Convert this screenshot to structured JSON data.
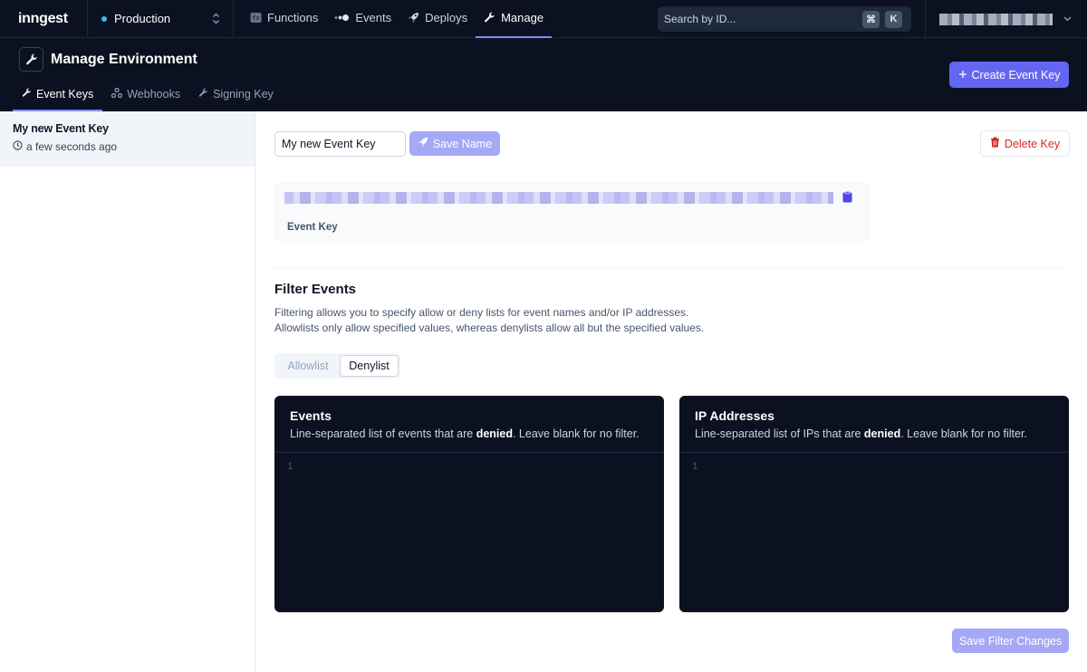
{
  "nav": {
    "logo": "inngest",
    "environment": "Production",
    "items": [
      {
        "label": "Functions",
        "icon": "functions-icon"
      },
      {
        "label": "Events",
        "icon": "events-icon"
      },
      {
        "label": "Deploys",
        "icon": "rocket-icon"
      },
      {
        "label": "Manage",
        "icon": "wrench-icon",
        "active": true
      }
    ],
    "search": {
      "placeholder": "Search by ID...",
      "shortcut_mod": "⌘",
      "shortcut_key": "K"
    }
  },
  "header": {
    "title": "Manage Environment",
    "tabs": [
      {
        "label": "Event Keys",
        "icon": "key-icon",
        "active": true
      },
      {
        "label": "Webhooks",
        "icon": "webhook-icon"
      },
      {
        "label": "Signing Key",
        "icon": "key-icon"
      }
    ],
    "create_button": "Create Event Key"
  },
  "sidebar": {
    "keys": [
      {
        "name": "My new Event Key",
        "time": "a few seconds ago"
      }
    ]
  },
  "main": {
    "name_value": "My new Event Key",
    "save_name": "Save Name",
    "delete_key": "Delete Key",
    "key_label": "Event Key",
    "filter": {
      "title": "Filter Events",
      "desc_line1": "Filtering allows you to specify allow or deny lists for event names and/or IP addresses.",
      "desc_line2": "Allowlists only allow specified values, whereas denylists allow all but the specified values.",
      "modes": [
        "Allowlist",
        "Denylist"
      ],
      "selected_mode": "Denylist"
    },
    "events_editor": {
      "title": "Events",
      "desc_before": "Line-separated list of events that are ",
      "desc_emph": "denied",
      "desc_after": ". Leave blank for no filter.",
      "line_number": "1"
    },
    "ips_editor": {
      "title": "IP Addresses",
      "desc_before": "Line-separated list of IPs that are ",
      "desc_emph": "denied",
      "desc_after": ". Leave blank for no filter.",
      "line_number": "1"
    },
    "save_filter": "Save Filter Changes"
  },
  "colors": {
    "accent": "#6366f1",
    "accent_disabled": "#a5a8f5",
    "nav_bg": "#0b1120",
    "danger": "#dc2626"
  }
}
